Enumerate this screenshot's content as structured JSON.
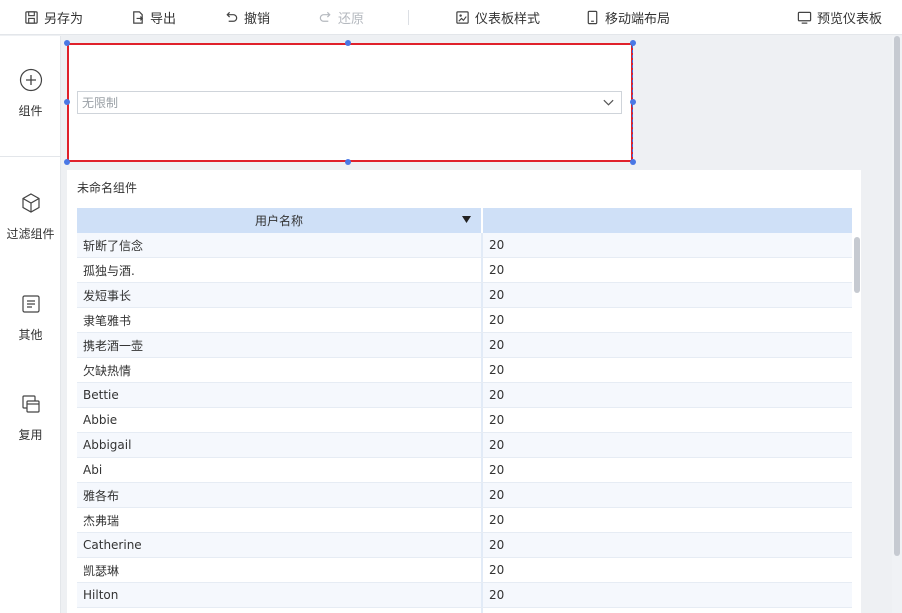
{
  "toolbar": {
    "save_as": "另存为",
    "export": "导出",
    "undo": "撤销",
    "redo": "还原",
    "dashboard_style": "仪表板样式",
    "mobile_layout": "移动端布局",
    "preview": "预览仪表板"
  },
  "sidebar": {
    "items": [
      {
        "label": "组件",
        "icon": "plus-circle-icon"
      },
      {
        "label": "过滤组件",
        "icon": "cube-icon"
      },
      {
        "label": "其他",
        "icon": "document-icon"
      },
      {
        "label": "复用",
        "icon": "copy-icon"
      }
    ]
  },
  "filter": {
    "placeholder": "无限制"
  },
  "table_widget": {
    "title": "未命名组件",
    "columns": [
      "用户名称",
      ""
    ],
    "rows": [
      {
        "name": "斩断了信念",
        "value": "20"
      },
      {
        "name": "孤独与酒.",
        "value": "20"
      },
      {
        "name": "发短事长",
        "value": "20"
      },
      {
        "name": "隶笔雅书",
        "value": "20"
      },
      {
        "name": "携老酒一壶",
        "value": "20"
      },
      {
        "name": "欠缺热情",
        "value": "20"
      },
      {
        "name": "Bettie",
        "value": "20"
      },
      {
        "name": "Abbie",
        "value": "20"
      },
      {
        "name": "Abbigail",
        "value": "20"
      },
      {
        "name": "Abi",
        "value": "20"
      },
      {
        "name": "雅各布",
        "value": "20"
      },
      {
        "name": "杰弗瑞",
        "value": "20"
      },
      {
        "name": "Catherine",
        "value": "20"
      },
      {
        "name": "凯瑟琳",
        "value": "20"
      },
      {
        "name": "Hilton",
        "value": "20"
      },
      {
        "name": "",
        "value": ""
      }
    ]
  },
  "colors": {
    "accent": "#4a78e5",
    "selection_border": "#e0212b",
    "header_bg": "#cfe0f7"
  }
}
